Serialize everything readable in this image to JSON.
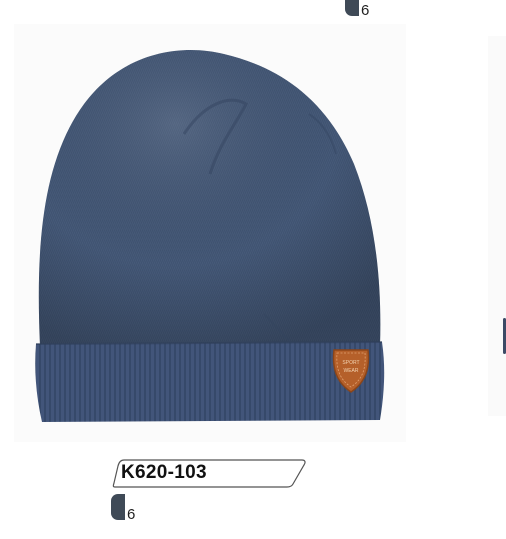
{
  "product": {
    "code": "K620-103",
    "image_alt": "Navy knitted beanie with leather patch"
  },
  "badges": {
    "top_size": "6",
    "bottom_size": "6"
  },
  "patch": {
    "line1": "SPORT",
    "line2": "WEAR"
  },
  "colors": {
    "hat": "#465a78",
    "hat_dark": "#34455f",
    "patch": "#b5602a",
    "badge": "#3f4a57"
  }
}
